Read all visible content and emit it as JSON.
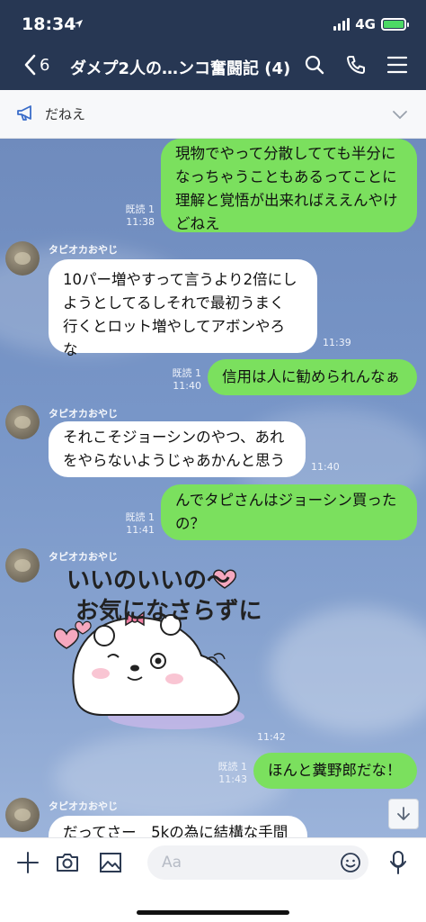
{
  "status": {
    "time": "18:34",
    "network": "4G"
  },
  "nav": {
    "back_count": "6",
    "title": "ダメプ2人の…ンコ奮闘記 (4)"
  },
  "icons": {
    "back": "chevron-left-icon",
    "search": "search-icon",
    "call": "phone-icon",
    "menu": "hamburger-menu-icon",
    "notice": "megaphone-icon",
    "notice_expand": "chevron-down-icon",
    "scroll": "arrow-down-icon",
    "add": "plus-icon",
    "camera": "camera-icon",
    "image": "image-icon",
    "emoji": "emoji-icon",
    "mic": "microphone-icon"
  },
  "notice": {
    "text": "だねえ"
  },
  "colors": {
    "header": "#273753",
    "out_bubble": "#7be05e",
    "in_bubble": "#ffffff",
    "battery": "#4cd964"
  },
  "messages": [
    {
      "dir": "out",
      "lines": [
        "現物でやって分散してても半分に",
        "なっちゃうこともあるってことに",
        "理解と覚悟が出来ればええんやけ",
        "どねえ"
      ],
      "read": "既読 1",
      "time": "11:38"
    },
    {
      "dir": "in",
      "sender": "タピオカおやじ",
      "lines": [
        "10パー増やすって言うより2倍にし",
        "ようとしてるしそれで最初うまく",
        "行くとロット増やしてアボンやろ",
        "な"
      ],
      "time": "11:39"
    },
    {
      "dir": "out",
      "lines": [
        "信用は人に勧められんなぁ"
      ],
      "read": "既読 1",
      "time": "11:40"
    },
    {
      "dir": "in",
      "sender": "タピオカおやじ",
      "lines": [
        "それこそジョーシンのやつ、あれ",
        "をやらないようじゃあかんと思う"
      ],
      "time": "11:40"
    },
    {
      "dir": "out",
      "lines": [
        "んでタピさんはジョーシン買った",
        "の？"
      ],
      "read": "既読 1",
      "time": "11:41"
    },
    {
      "dir": "sticker",
      "sender": "タピオカおやじ",
      "sticker_text": [
        "いいのいいの～",
        "お気になさらずに"
      ],
      "time": "11:42"
    },
    {
      "dir": "out",
      "lines": [
        "ほんと糞野郎だな！"
      ],
      "read": "既読 1",
      "time": "11:43"
    },
    {
      "dir": "in",
      "sender": "タピオカおやじ",
      "lines": [
        "だってさー　5kの為に結構な手間"
      ]
    }
  ],
  "input": {
    "placeholder": "Aa"
  }
}
